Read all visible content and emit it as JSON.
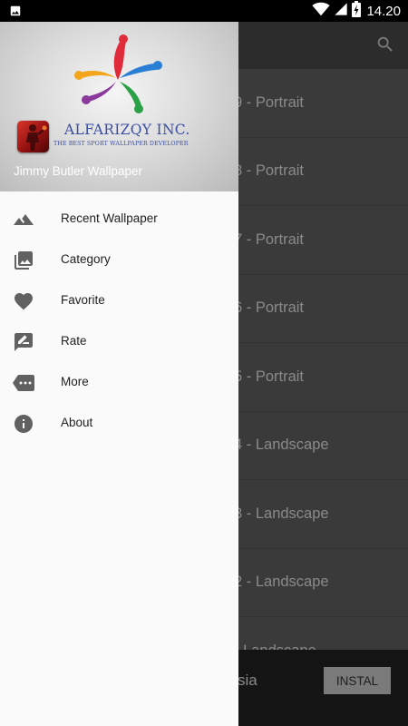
{
  "status_bar": {
    "time": "14.20",
    "icons": [
      "image-icon",
      "wifi-icon",
      "signal-icon",
      "battery-charging-icon"
    ]
  },
  "background": {
    "list_items": [
      "9 - Portrait",
      "8 - Portrait",
      "7 - Portrait",
      "6 - Portrait",
      "5 - Portrait",
      "4 - Landscape",
      "3 - Landscape",
      "2 - Landscape",
      "- Landscape"
    ],
    "ad_text": "sia",
    "ad_button": "INSTAL"
  },
  "drawer": {
    "brand_name": "ALFARIZQY INC.",
    "brand_tagline": "THE BEST SPORT WALLPAPER DEVELOPER",
    "app_name": "Jimmy Butler Wallpaper",
    "menu": [
      {
        "label": "Recent Wallpaper",
        "icon": "landscape-icon"
      },
      {
        "label": "Category",
        "icon": "photo-library-icon"
      },
      {
        "label": "Favorite",
        "icon": "heart-icon"
      },
      {
        "label": "Rate",
        "icon": "rate-review-icon"
      },
      {
        "label": "More",
        "icon": "more-tag-icon"
      },
      {
        "label": "About",
        "icon": "info-icon"
      }
    ]
  },
  "colors": {
    "drawer_bg": "#fafafa",
    "icon_color": "#616161",
    "brand_color": "#3b4fa2"
  }
}
